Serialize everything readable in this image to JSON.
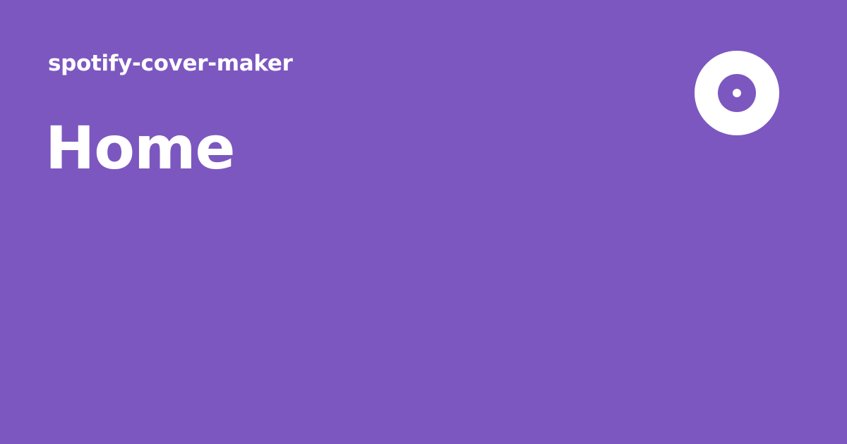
{
  "site": {
    "name": "spotify-cover-maker",
    "logo_icon": "disc-icon"
  },
  "page": {
    "title": "Home"
  },
  "colors": {
    "background": "#7c57c0",
    "text": "#ffffff",
    "logo": "#ffffff"
  }
}
